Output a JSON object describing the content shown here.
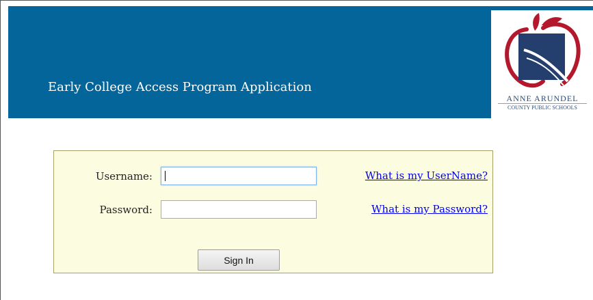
{
  "header": {
    "title": "Early College Access Program Application",
    "background_color": "#04659b"
  },
  "logo": {
    "line1": "ANNE ARUNDEL",
    "line2": "COUNTY PUBLIC SCHOOLS"
  },
  "login": {
    "username_label": "Username:",
    "username_value": "",
    "password_label": "Password:",
    "password_value": "",
    "username_help_link": "What is my UserName?",
    "password_help_link": "What is my Password?",
    "sign_in_label": "Sign In",
    "box_background": "#fcfce0"
  }
}
